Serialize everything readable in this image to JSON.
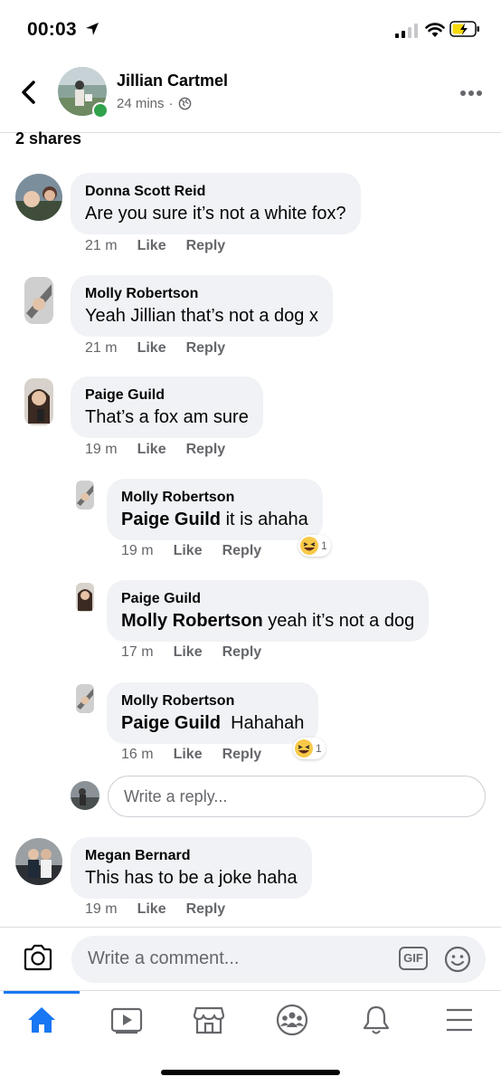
{
  "status_bar": {
    "time": "00:03"
  },
  "post": {
    "author": "Jillian Cartmel",
    "time": "24 mins"
  },
  "shares_label": "2 shares",
  "comments": [
    {
      "name": "Donna Scott Reid",
      "text": "Are you sure it’s not a white fox?",
      "time": "21 m",
      "like": "Like",
      "reply": "Reply"
    },
    {
      "name": "Molly Robertson",
      "text": "Yeah Jillian that’s not a dog x",
      "time": "21 m",
      "like": "Like",
      "reply": "Reply"
    },
    {
      "name": "Paige Guild",
      "text": "That’s a fox am sure",
      "time": "19 m",
      "like": "Like",
      "reply": "Reply"
    }
  ],
  "replies": [
    {
      "name": "Molly Robertson",
      "mention": "Paige Guild",
      "text": " it is ahaha",
      "time": "19 m",
      "like": "Like",
      "reply": "Reply",
      "reaction_count": "1",
      "reaction": "laughing"
    },
    {
      "name": "Paige Guild",
      "mention": "Molly Robertson",
      "text": " yeah it’s not a dog",
      "time": "17 m",
      "like": "Like",
      "reply": "Reply"
    },
    {
      "name": "Molly Robertson",
      "mention": "Paige Guild",
      "text": "  Hahahah",
      "time": "16 m",
      "like": "Like",
      "reply": "Reply",
      "reaction_count": "1",
      "reaction": "laughing"
    }
  ],
  "reply_input": {
    "placeholder": "Write a reply..."
  },
  "last_comment": {
    "name": "Megan Bernard",
    "text": "This has to be a joke haha",
    "time": "19 m",
    "like": "Like",
    "reply": "Reply"
  },
  "composer": {
    "placeholder": "Write a comment...",
    "gif_label": "GIF"
  },
  "tabs": [
    "home-icon",
    "watch-icon",
    "marketplace-icon",
    "groups-icon",
    "notifications-icon",
    "menu-icon"
  ],
  "colors": {
    "accent": "#1877f2",
    "online": "#31a24c",
    "bubble": "#f0f2f5",
    "secondary_text": "#65676b"
  }
}
